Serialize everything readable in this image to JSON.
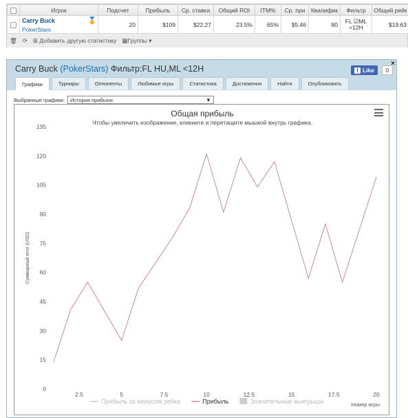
{
  "stats_table": {
    "headers": [
      "Игрок",
      "Подсчет",
      "Прибыль",
      "Ср. ставка",
      "Общий ROI",
      "ITM%",
      "Ср. при",
      "Квалифик",
      "Фильтр",
      "Общий рейк"
    ],
    "row": {
      "player_name": "Carry Buck",
      "player_site": "PokerStars",
      "count": "20",
      "profit": "$109",
      "avg_stake": "$22.27",
      "roi": "23.5%",
      "itm": "65%",
      "avg_prize": "$5.46",
      "qualif": "80",
      "filter": "FL ☑ML <12H",
      "rake": "$19.63"
    },
    "toolbar": {
      "add_stat": "Добавить другую статистику",
      "groups": "Группы"
    }
  },
  "panel": {
    "title_name": "Carry Buck",
    "title_site": "(PokerStars)",
    "title_filter": "Фильтр:FL HU,ML <12H",
    "fb_like": "Like",
    "fb_count": "0",
    "close": "×",
    "tabs": [
      "Графики",
      "Турниры",
      "Оппоненты",
      "Любимые игры",
      "Статистика",
      "Достижения",
      "Найти",
      "Опубликовать"
    ],
    "graph_select_label": "Выбранные графики:",
    "graph_select_value": "История прибыли"
  },
  "chart_data": {
    "type": "line",
    "title": "Общая прибыль",
    "subtitle": "Чтобы увеличить изображение, кликните и перетащите мышкой внутрь графика.",
    "xlabel": "Номер игры",
    "ylabel": "Суммарный итог (USD)",
    "xlim": [
      1,
      20
    ],
    "ylim": [
      0,
      135
    ],
    "xticks": [
      "2.5",
      "5",
      "7.5",
      "10",
      "12.5",
      "15",
      "17.5",
      "20"
    ],
    "yticks": [
      "0",
      "15",
      "30",
      "45",
      "60",
      "75",
      "90",
      "105",
      "120",
      "135"
    ],
    "series": [
      {
        "name": "Прибыль",
        "color": "#c98c8c",
        "x": [
          1,
          2,
          3,
          4,
          5,
          6,
          7,
          8,
          9,
          10,
          11,
          12,
          13,
          14,
          15,
          16,
          17,
          18,
          19,
          20
        ],
        "y": [
          14,
          41,
          55,
          40,
          25,
          52,
          65,
          78,
          93,
          121,
          91,
          119,
          104,
          117,
          87,
          57,
          85,
          55,
          82,
          109
        ]
      }
    ],
    "legend": [
      {
        "label": "Прибыль за минусом рейка",
        "color": "#cccccc",
        "kind": "line",
        "dim": true
      },
      {
        "label": "Прибыль",
        "color": "#c98c8c",
        "kind": "line",
        "dim": false
      },
      {
        "label": "Значительные выигрыши",
        "color": "#cccccc",
        "kind": "box",
        "dim": true
      }
    ],
    "legend_position": "bottom-center",
    "grid": false
  }
}
